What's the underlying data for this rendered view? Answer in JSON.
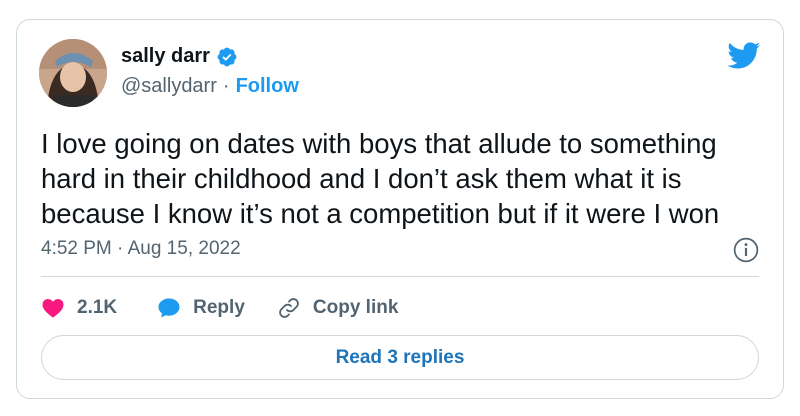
{
  "author": {
    "display_name": "sally darr",
    "handle": "@sallydarr",
    "separator": "·",
    "follow_label": "Follow",
    "verified_icon": "verified-badge-icon"
  },
  "tweet": {
    "text": "I love going on dates with boys that allude to something\nhard in their childhood and I don’t ask them what it is\nbecause I know it’s not a competition but if it were I won",
    "timestamp": "4:52 PM · Aug 15, 2022"
  },
  "actions": {
    "like_count": "2.1K",
    "reply_label": "Reply",
    "copy_link_label": "Copy link"
  },
  "footer": {
    "read_replies_label": "Read 3 replies"
  },
  "colors": {
    "brand_blue": "#1d9bf0",
    "like_red": "#f91880",
    "text_primary": "#0f1419",
    "text_secondary": "#536471",
    "border": "#cfd9de"
  }
}
